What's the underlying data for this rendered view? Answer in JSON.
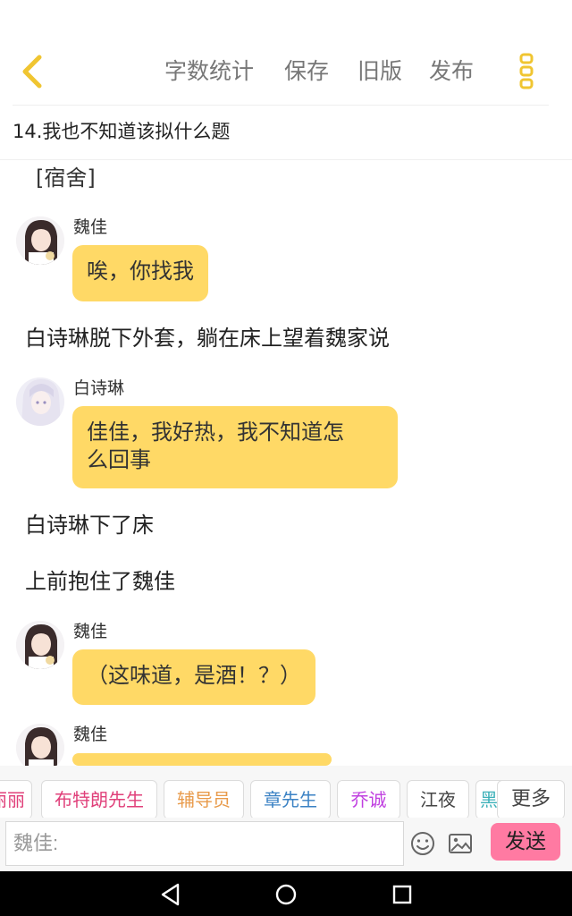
{
  "toolbar": {
    "word_count": "字数统计",
    "save": "保存",
    "old_version": "旧版",
    "publish": "发布"
  },
  "title": "14.我也不知道该拟什么题",
  "scene_tag": "[宿舍]",
  "messages": [
    {
      "name": "魏佳",
      "lines": [
        "唉，你找我"
      ]
    },
    {
      "name": "白诗琳",
      "lines": [
        "佳佳，我好热，我不知道怎",
        "么回事"
      ]
    },
    {
      "name": "魏佳",
      "lines": [
        "（这味道，是酒！？）"
      ]
    },
    {
      "name": "魏佳"
    }
  ],
  "narrations": [
    "白诗琳脱下外套，躺在床上望着魏家说",
    "白诗琳下了床",
    "上前抱住了魏佳"
  ],
  "chips": [
    {
      "label": "丽丽",
      "color": "#e0407a"
    },
    {
      "label": "布特朗先生",
      "color": "#e0407a"
    },
    {
      "label": "辅导员",
      "color": "#e89a4a"
    },
    {
      "label": "章先生",
      "color": "#3b82c4"
    },
    {
      "label": "乔诚",
      "color": "#c040e0"
    },
    {
      "label": "江夜",
      "color": "#444444"
    },
    {
      "label": "黑",
      "color": "#3bb0b8"
    }
  ],
  "more_label": "更多",
  "input": {
    "placeholder": "魏佳:"
  },
  "send_label": "发送",
  "icons": {
    "back": "chevron-left-icon",
    "menu": "more-vertical-icon",
    "emoji": "emoji-icon",
    "image": "image-icon"
  },
  "colors": {
    "accent_yellow": "#ffd966",
    "send_pink": "#ff7aa2",
    "back_arrow": "#f0c531"
  }
}
